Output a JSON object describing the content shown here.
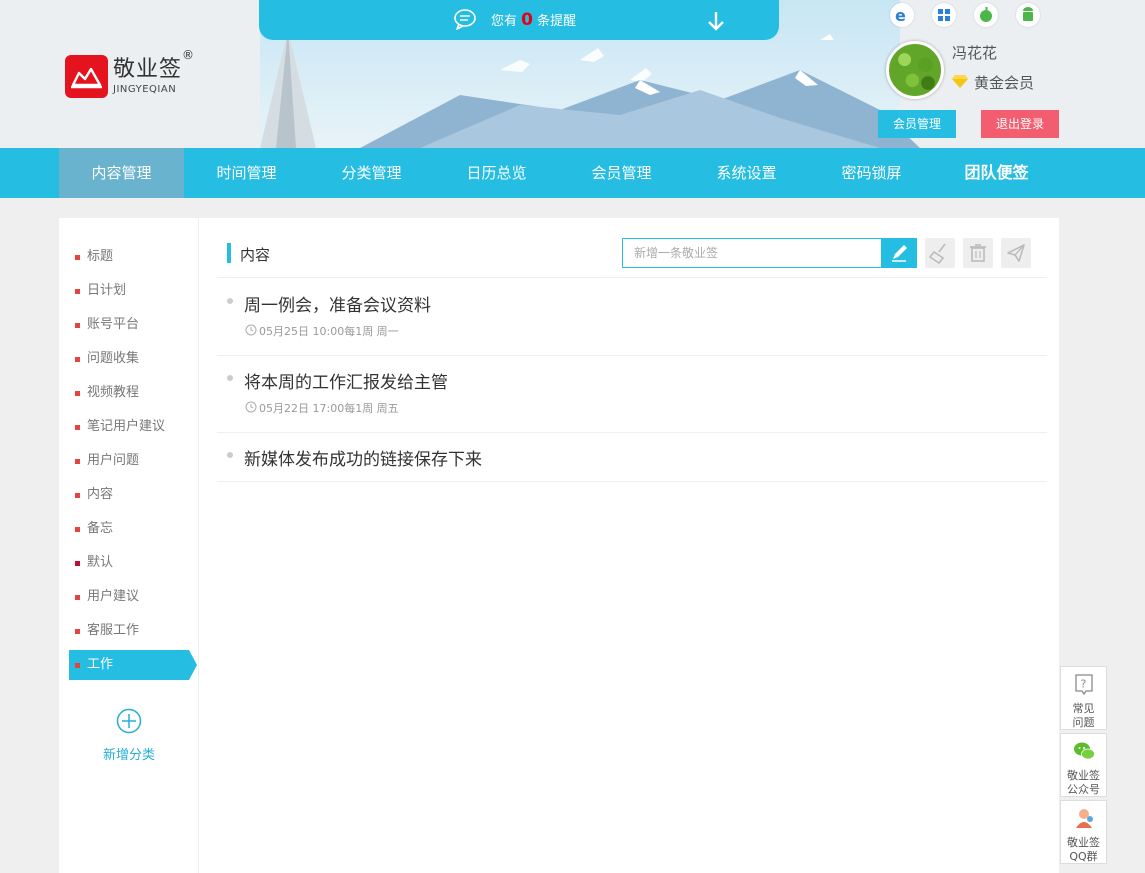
{
  "notification": {
    "prefix": "您有",
    "count": "0",
    "suffix": "条提醒"
  },
  "logo": {
    "name": "敬业签",
    "registered": "®",
    "subtitle": "JINGYEQIAN"
  },
  "platforms": [
    "ie-icon",
    "windows-icon",
    "apple-icon",
    "android-icon"
  ],
  "user": {
    "name": "冯花花",
    "level": "黄金会员",
    "member_button": "会员管理",
    "logout_button": "退出登录"
  },
  "nav": {
    "items": [
      {
        "label": "内容管理"
      },
      {
        "label": "时间管理"
      },
      {
        "label": "分类管理"
      },
      {
        "label": "日历总览"
      },
      {
        "label": "会员管理"
      },
      {
        "label": "系统设置"
      },
      {
        "label": "密码锁屏"
      },
      {
        "label": "团队便签"
      }
    ],
    "active_index": 0
  },
  "sidebar": {
    "categories": [
      {
        "label": "标题"
      },
      {
        "label": "日计划"
      },
      {
        "label": "账号平台"
      },
      {
        "label": "问题收集"
      },
      {
        "label": "视频教程"
      },
      {
        "label": "笔记用户建议"
      },
      {
        "label": "用户问题"
      },
      {
        "label": "内容"
      },
      {
        "label": "备忘"
      },
      {
        "label": "默认"
      },
      {
        "label": "用户建议"
      },
      {
        "label": "客服工作"
      },
      {
        "label": "工作"
      }
    ],
    "active_index": 12,
    "add_label": "新增分类"
  },
  "content": {
    "title": "内容",
    "search_placeholder": "新增一条敬业签",
    "notes": [
      {
        "title": "周一例会，准备会议资料",
        "time": "05月25日 10:00每1周 周一"
      },
      {
        "title": "将本周的工作汇报发给主管",
        "time": "05月22日 17:00每1周 周五"
      },
      {
        "title": "新媒体发布成功的链接保存下来",
        "time": ""
      }
    ]
  },
  "float_panel": {
    "faq": "常见\n问题",
    "faq_1": "常见",
    "faq_2": "问题",
    "wechat_1": "敬业签",
    "wechat_2": "公众号",
    "qq_1": "敬业签",
    "qq_2": "QQ群"
  },
  "colors": {
    "primary": "#25bde1",
    "logout": "#f25e6f",
    "brand_red": "#e4131d",
    "active_nav": "#6ab3cf"
  }
}
